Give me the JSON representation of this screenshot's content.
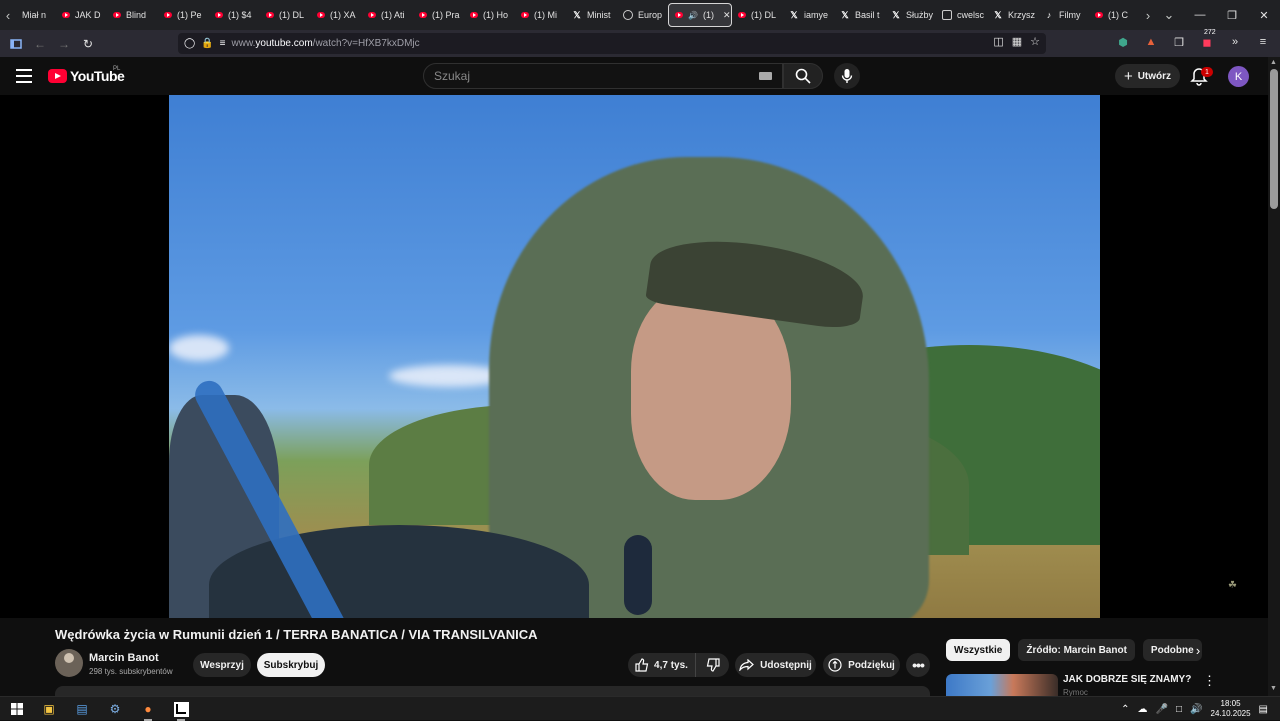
{
  "browser": {
    "tabs": [
      {
        "label": "Miał n",
        "icon": "none"
      },
      {
        "label": "JAK D",
        "icon": "youtube-icon"
      },
      {
        "label": "Blind",
        "icon": "youtube-icon"
      },
      {
        "label": "(1) Pe",
        "icon": "youtube-icon"
      },
      {
        "label": "(1) $4",
        "icon": "youtube-icon"
      },
      {
        "label": "(1) DL",
        "icon": "youtube-icon"
      },
      {
        "label": "(1) XA",
        "icon": "youtube-icon"
      },
      {
        "label": "(1) Ati",
        "icon": "youtube-icon"
      },
      {
        "label": "(1) Pra",
        "icon": "youtube-icon"
      },
      {
        "label": "(1) Ho",
        "icon": "youtube-icon"
      },
      {
        "label": "(1) Mi",
        "icon": "youtube-icon"
      },
      {
        "label": "Minist",
        "icon": "x-icon"
      },
      {
        "label": "Europ",
        "icon": "globe-icon"
      },
      {
        "label": "(1) ",
        "icon": "youtube-icon",
        "active": true
      },
      {
        "label": "(1) DL",
        "icon": "youtube-icon"
      },
      {
        "label": "iamye",
        "icon": "x-icon"
      },
      {
        "label": "Basil t",
        "icon": "x-icon"
      },
      {
        "label": "Służby",
        "icon": "x-icon"
      },
      {
        "label": "cwelsc",
        "icon": "grid-icon"
      },
      {
        "label": "Krzysz",
        "icon": "x-icon"
      },
      {
        "label": "Filmy",
        "icon": "tiktok-icon"
      },
      {
        "label": "(1) C",
        "icon": "youtube-icon"
      }
    ],
    "url_prefix": "www.",
    "url_host": "youtube.com",
    "url_path": "/watch?v=HfXB7kxDMjc",
    "extension_badge": "272"
  },
  "youtube": {
    "logo_text": "YouTube",
    "country": "PL",
    "search_placeholder": "Szukaj",
    "create_label": "Utwórz",
    "notifications_count": "1",
    "avatar_letter": "K"
  },
  "video": {
    "title": "Wędrówka życia w Rumunii dzień 1 / TERRA BANATICA / VIA TRANSILVANICA",
    "channel_name": "Marcin Banot",
    "subscribers": "298 tys. subskrybentów",
    "support_label": "Wesprzyj",
    "subscribe_label": "Subskrybuj",
    "likes": "4,7 tys.",
    "share_label": "Udostępnij",
    "thanks_label": "Podziękuj"
  },
  "sidebar": {
    "chips": [
      "Wszystkie",
      "Źródło: Marcin Banot",
      "Podobne"
    ],
    "recommendation": {
      "title": "JAK DOBRZE SIĘ ZNAMY?",
      "channel": "Rymoc"
    }
  },
  "taskbar": {
    "time": "18:05",
    "date": "24.10.2025"
  }
}
